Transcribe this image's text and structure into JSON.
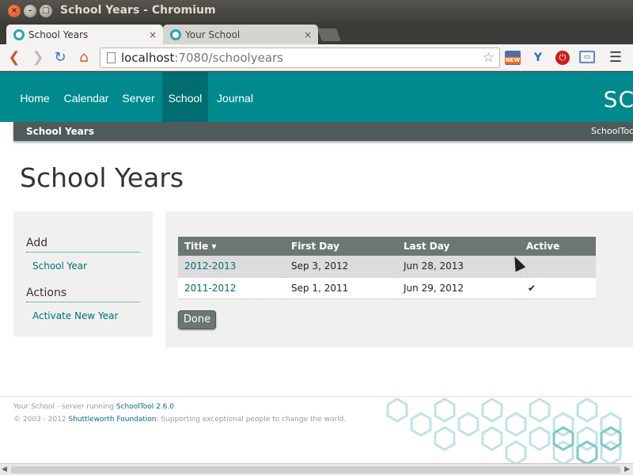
{
  "window": {
    "title": "School Years - Chromium"
  },
  "tabs": [
    {
      "label": "School Years",
      "close": "×"
    },
    {
      "label": "Your School",
      "close": "×"
    }
  ],
  "toolbar": {
    "url_host": "localhost",
    "url_path": ":7080/schoolyears",
    "ext_new_label": "NEW"
  },
  "nav": {
    "items": [
      "Home",
      "Calendar",
      "Server",
      "School",
      "Journal"
    ],
    "active": "School",
    "brand": "SC"
  },
  "subnav": {
    "title": "School Years",
    "right": "SchoolToo"
  },
  "page": {
    "title": "School Years"
  },
  "sidebar": {
    "add_heading": "Add",
    "add_link": "School Year",
    "actions_heading": "Actions",
    "actions_link": "Activate New Year"
  },
  "table": {
    "headers": [
      "Title ▾",
      "First Day",
      "Last Day",
      "Active"
    ],
    "rows": [
      {
        "title": "2012-2013",
        "first": "Sep 3, 2012",
        "last": "Jun 28, 2013",
        "active": ""
      },
      {
        "title": "2011-2012",
        "first": "Sep 1, 2011",
        "last": "Jun 29, 2012",
        "active": "✔"
      }
    ]
  },
  "done_label": "Done",
  "footer": {
    "line1_prefix": "Your School - server running ",
    "line1_link": "SchoolTool 2.6.0",
    "line2_prefix": "© 2003 - 2012 ",
    "line2_link": "Shuttleworth Foundation",
    "line2_suffix": ": Supporting exceptional people to change the world."
  },
  "colors": {
    "teal": "#008a8d",
    "teal_dark": "#006e71",
    "slate": "#4f5b5b"
  }
}
